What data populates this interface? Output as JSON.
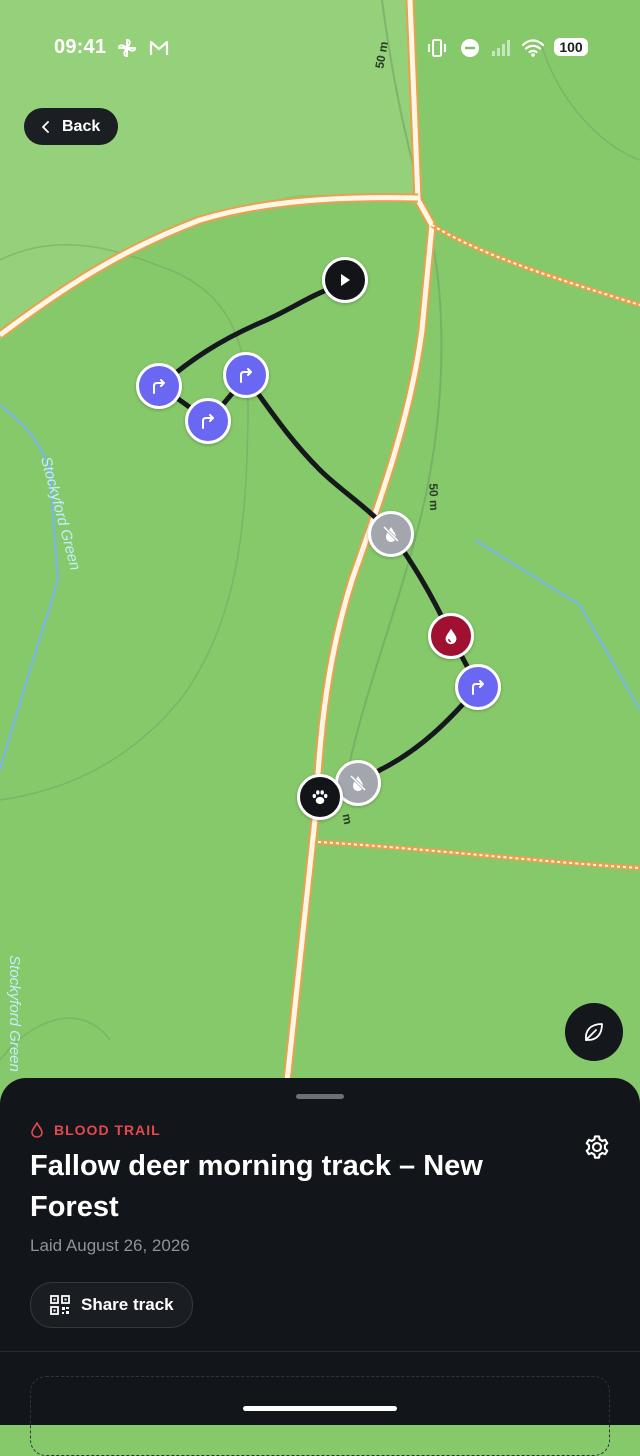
{
  "status_bar": {
    "time": "09:41",
    "battery": "100",
    "icons": [
      "pinwheel-icon",
      "gmail-icon",
      "vibrate-icon",
      "dnd-icon",
      "signal-icon",
      "wifi-icon",
      "battery-icon"
    ]
  },
  "nav": {
    "back_label": "Back"
  },
  "map": {
    "labels": {
      "contour_top": "50 m",
      "contour_mid": "50 m",
      "contour_low": "m",
      "place_1": "Stockyford Green",
      "place_2": "Stockyford Green"
    },
    "markers": [
      {
        "type": "start",
        "icon": "play-icon"
      },
      {
        "type": "turn",
        "icon": "turn-right-icon"
      },
      {
        "type": "turn",
        "icon": "turn-right-icon"
      },
      {
        "type": "turn",
        "icon": "turn-right-icon"
      },
      {
        "type": "no-blood",
        "icon": "no-blood-icon"
      },
      {
        "type": "blood",
        "icon": "blood-drop-icon"
      },
      {
        "type": "turn",
        "icon": "turn-right-icon"
      },
      {
        "type": "no-blood",
        "icon": "no-blood-icon"
      },
      {
        "type": "end",
        "icon": "paw-icon"
      }
    ],
    "layer_button_icon": "leaf-icon",
    "colors": {
      "map_green": "#86c96a",
      "track": "#15181c",
      "turn": "#6a67f2",
      "blood": "#a01030",
      "no_blood": "#a3a6ad",
      "road": "#f4a94e"
    }
  },
  "sheet": {
    "eyebrow": "BLOOD TRAIL",
    "eyebrow_color": "#e5484d",
    "title": "Fallow deer morning track – New Forest",
    "subtitle": "Laid August 26, 2026",
    "share_label": "Share track",
    "settings_icon": "gear-icon"
  }
}
